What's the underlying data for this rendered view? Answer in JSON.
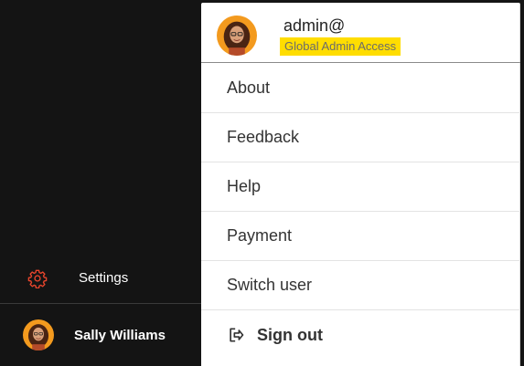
{
  "sidebar": {
    "settings_label": "Settings",
    "settings_icon": "gear-icon",
    "accent_color": "#e8452c",
    "user_name": "Sally Williams"
  },
  "account_panel": {
    "username": "admin@",
    "access_badge": "Global Admin Access",
    "badge_color": "#ffdd00",
    "menu": [
      {
        "label": "About"
      },
      {
        "label": "Feedback"
      },
      {
        "label": "Help"
      },
      {
        "label": "Payment"
      },
      {
        "label": "Switch user"
      }
    ],
    "sign_out_label": "Sign out",
    "sign_out_icon": "sign-out-icon"
  }
}
